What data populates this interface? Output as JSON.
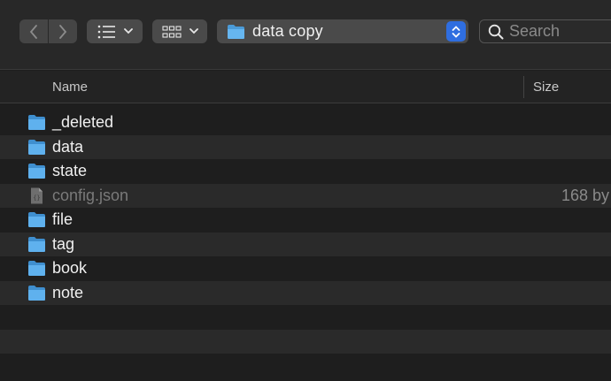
{
  "toolbar": {
    "back_icon": "chevron-left-icon",
    "forward_icon": "chevron-right-icon",
    "list_view_icon": "list-icon",
    "group_view_icon": "grid-icon",
    "path": {
      "label": "data copy",
      "icon": "folder-icon"
    },
    "search": {
      "placeholder": "Search",
      "value": ""
    }
  },
  "columns": {
    "name": "Name",
    "size": "Size"
  },
  "files": [
    {
      "name": "_deleted",
      "kind": "folder",
      "size": ""
    },
    {
      "name": "data",
      "kind": "folder",
      "size": ""
    },
    {
      "name": "state",
      "kind": "folder",
      "size": ""
    },
    {
      "name": "config.json",
      "kind": "file",
      "size": "168 by"
    },
    {
      "name": "file",
      "kind": "folder",
      "size": ""
    },
    {
      "name": "tag",
      "kind": "folder",
      "size": ""
    },
    {
      "name": "book",
      "kind": "folder",
      "size": ""
    },
    {
      "name": "note",
      "kind": "folder",
      "size": ""
    }
  ],
  "colors": {
    "folder": "#5fb1ee",
    "accent": "#2f6ee0"
  }
}
